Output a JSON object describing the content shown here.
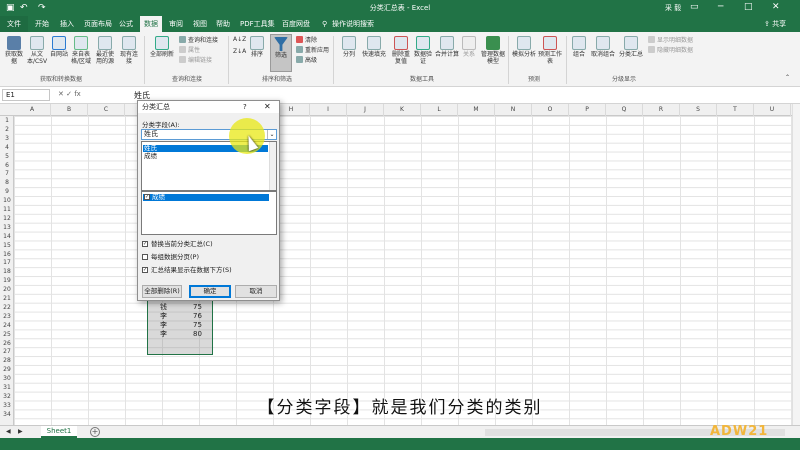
{
  "window": {
    "title": "分类汇总表 - Excel",
    "user": "采 毅",
    "share": "共享",
    "quick_access": [
      "save-icon",
      "undo-icon",
      "redo-icon"
    ]
  },
  "menu": {
    "tabs": [
      "文件",
      "开始",
      "插入",
      "页面布局",
      "公式",
      "数据",
      "审阅",
      "视图",
      "帮助",
      "PDF工具集",
      "百度网盘",
      "操作说明搜索"
    ],
    "active_tab": "数据"
  },
  "ribbon": {
    "groups": [
      {
        "label": "获取和转换数据",
        "buttons": [
          "获取数据",
          "从文本/CSV",
          "自网站",
          "来自表格/区域",
          "最近使用的源",
          "现有连接"
        ]
      },
      {
        "label": "查询和连接",
        "buttons": [
          "全部刷新"
        ],
        "small": [
          "查询和连接",
          "属性",
          "编辑链接"
        ]
      },
      {
        "label": "排序和筛选",
        "buttons": [
          "排序",
          "筛选"
        ],
        "small": [
          "清除",
          "重新应用",
          "高级"
        ]
      },
      {
        "label": "数据工具",
        "buttons": [
          "分列",
          "快速填充",
          "删除重复值",
          "数据验证",
          "合并计算",
          "关系",
          "管理数据模型"
        ]
      },
      {
        "label": "预测",
        "buttons": [
          "模拟分析",
          "预测工作表"
        ]
      },
      {
        "label": "分级显示",
        "buttons": [
          "组合",
          "取消组合",
          "分类汇总"
        ],
        "small": [
          "显示明细数据",
          "隐藏明细数据"
        ]
      }
    ]
  },
  "formula_bar": {
    "name_box": "E1",
    "value": "姓氏"
  },
  "grid": {
    "columns": [
      "A",
      "B",
      "C",
      "D",
      "E",
      "F",
      "G",
      "H",
      "I",
      "J",
      "K",
      "L",
      "M",
      "N",
      "O",
      "P",
      "Q",
      "R",
      "S",
      "T",
      "U"
    ],
    "rows": [
      "1",
      "2",
      "3",
      "4",
      "5",
      "6",
      "7",
      "8",
      "9",
      "10",
      "11",
      "12",
      "13",
      "14",
      "15",
      "16",
      "17",
      "18",
      "19",
      "20",
      "21",
      "22",
      "23",
      "24",
      "25",
      "26",
      "27",
      "28",
      "29",
      "30",
      "31",
      "32",
      "33",
      "34"
    ],
    "visible_cells": [
      {
        "name": "钱",
        "score": "77"
      },
      {
        "name": "钱",
        "score": "69"
      },
      {
        "name": "钱",
        "score": "75"
      },
      {
        "name": "李",
        "score": "76"
      },
      {
        "name": "李",
        "score": "75"
      },
      {
        "name": "李",
        "score": "80"
      }
    ]
  },
  "dialog": {
    "title": "分类汇总",
    "help": "?",
    "close": "✕",
    "field_label": "分类字段(A):",
    "selected_field": "姓氏",
    "field_options": [
      "姓氏",
      "成绩"
    ],
    "checked_item": "成绩",
    "options": [
      {
        "label": "替换当前分类汇总(C)",
        "checked": true
      },
      {
        "label": "每组数据分页(P)",
        "checked": false
      },
      {
        "label": "汇总结果显示在数据下方(S)",
        "checked": true
      }
    ],
    "buttons": {
      "remove_all": "全部删除(R)",
      "ok": "确定",
      "cancel": "取消"
    }
  },
  "sheets": {
    "tabs": [
      "Sheet1"
    ]
  },
  "subtitle": "【分类字段】就是我们分类的类别",
  "watermark": "ADW21",
  "colors": {
    "excel_green": "#217346",
    "highlight": "#e8e814",
    "selection": "#0078d7"
  }
}
